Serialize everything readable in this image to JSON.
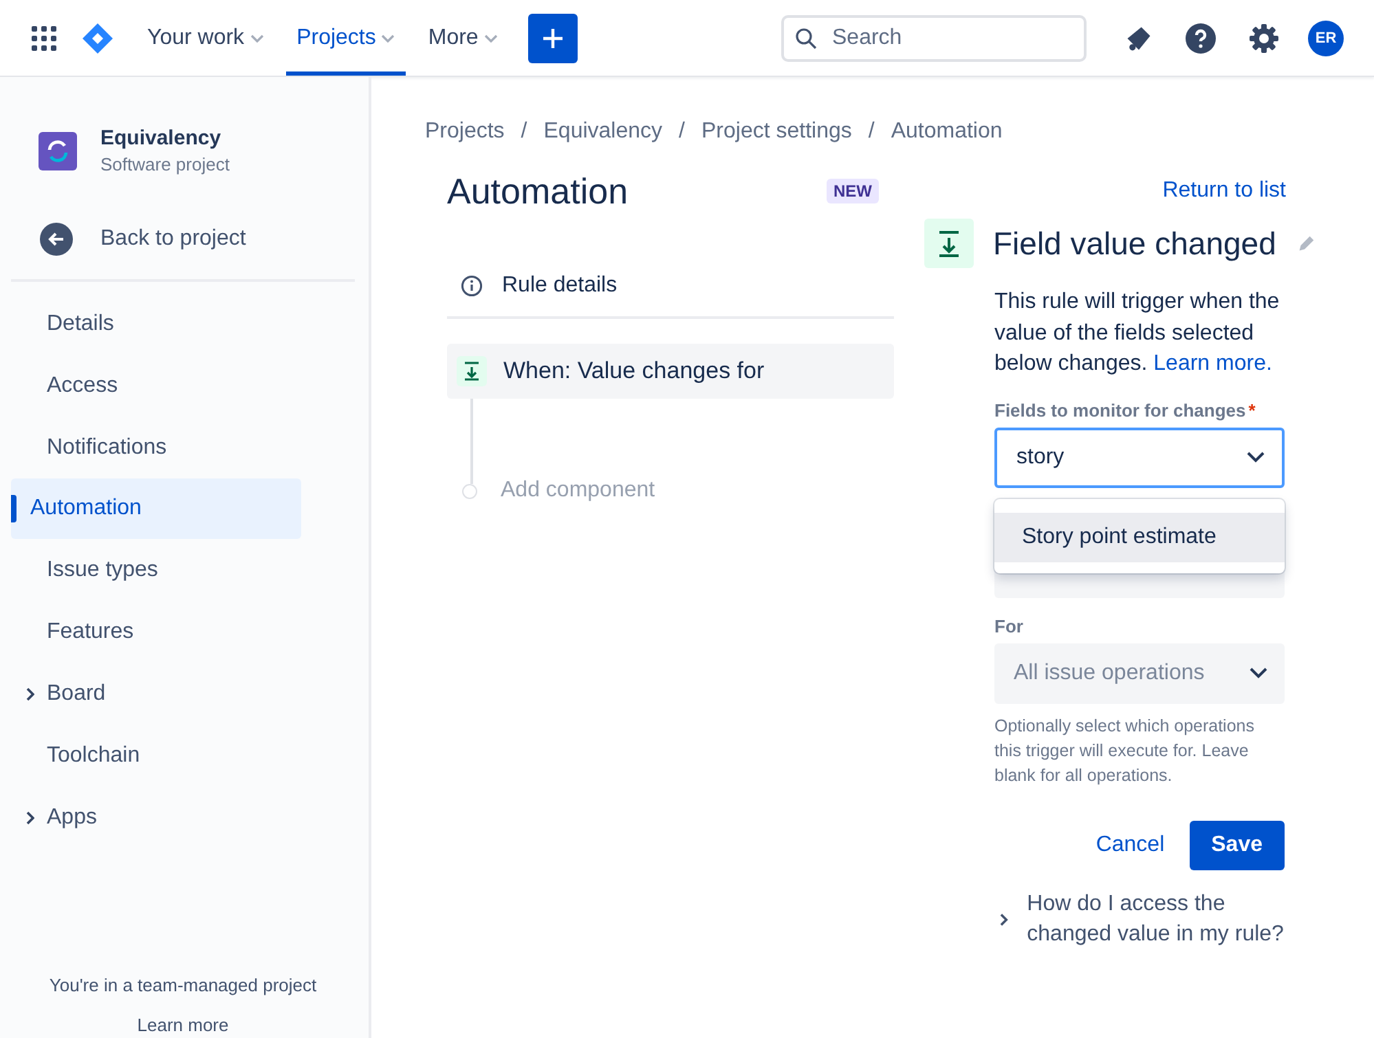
{
  "topbar": {
    "nav": [
      {
        "label": "Your work",
        "selected": false
      },
      {
        "label": "Projects",
        "selected": true
      },
      {
        "label": "More",
        "selected": false
      }
    ],
    "search": {
      "placeholder": "Search"
    },
    "avatar": "ER"
  },
  "sidebar": {
    "project": {
      "name": "Equivalency",
      "type": "Software project"
    },
    "back": "Back to project",
    "items": [
      {
        "label": "Details",
        "selected": false,
        "expandable": false
      },
      {
        "label": "Access",
        "selected": false,
        "expandable": false
      },
      {
        "label": "Notifications",
        "selected": false,
        "expandable": false
      },
      {
        "label": "Automation",
        "selected": true,
        "expandable": false
      },
      {
        "label": "Issue types",
        "selected": false,
        "expandable": false
      },
      {
        "label": "Features",
        "selected": false,
        "expandable": false
      },
      {
        "label": "Board",
        "selected": false,
        "expandable": true
      },
      {
        "label": "Toolchain",
        "selected": false,
        "expandable": false
      },
      {
        "label": "Apps",
        "selected": false,
        "expandable": true
      }
    ],
    "footer": {
      "text": "You're in a team-managed project",
      "link": "Learn more"
    }
  },
  "breadcrumbs": [
    "Projects",
    "Equivalency",
    "Project settings",
    "Automation"
  ],
  "breadcrumb_separator": "/",
  "title": "Automation",
  "badge": "NEW",
  "return_link": "Return to list",
  "rule": {
    "details": "Rule details",
    "trigger": "When: Value changes for",
    "add": "Add component"
  },
  "panel": {
    "title": "Field value changed",
    "description": "This rule will trigger when the value of the fields selected below changes.",
    "learn_more": "Learn more.",
    "fields_label": "Fields to monitor for changes",
    "required_mark": "*",
    "fields_value": "story",
    "options": [
      {
        "label": "Story point estimate",
        "selected": true
      }
    ],
    "for_label": "For",
    "for_placeholder": "All issue operations",
    "help": "Optionally select which operations this trigger will execute for. Leave blank for all operations.",
    "cancel": "Cancel",
    "save": "Save",
    "faq": "How do I access the changed value in my rule?"
  }
}
